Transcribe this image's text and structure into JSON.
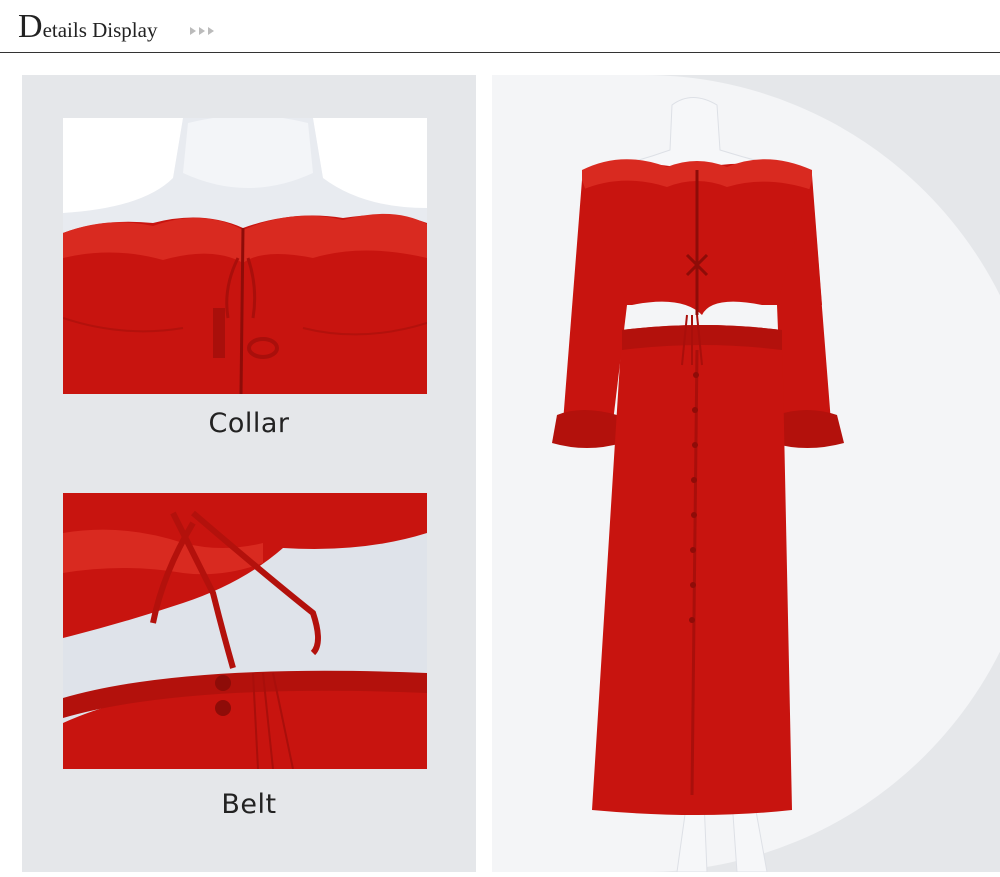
{
  "header": {
    "title_initial": "D",
    "title_rest": "etails Display"
  },
  "details": [
    {
      "caption": "Collar",
      "image": "red-off-shoulder-ruffle-collar-closeup"
    },
    {
      "caption": "Belt",
      "image": "red-tie-waist-tassel-closeup"
    }
  ],
  "main_image": "red-off-shoulder-crop-top-and-maxi-skirt-on-mannequin",
  "colors": {
    "fabric": "#c8140f",
    "panel": "#e5e7ea",
    "rule": "#333333"
  }
}
